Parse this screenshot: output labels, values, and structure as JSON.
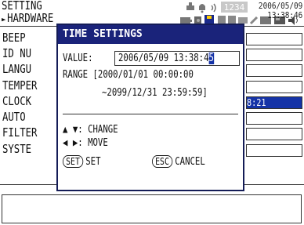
{
  "header": {
    "title": "SETTING",
    "subtitle": "HARDWARE",
    "date": "2006/05/09",
    "time": "13:38:46",
    "status_counter": "1234"
  },
  "menu": {
    "items": [
      "BEEP",
      "ID NU",
      "LANGU",
      "TEMPER",
      "CLOCK",
      "AUTO ",
      "FILTER",
      "SYSTE"
    ],
    "clock_value": "8:21"
  },
  "dialog": {
    "title": "TIME SETTINGS",
    "value_label": "VALUE:",
    "value_text": "2006/05/09 13:38:4",
    "value_cursor_char": "5",
    "range_line1": "RANGE [2000/01/01 00:00:00",
    "range_line2": "~2099/12/31 23:59:59]",
    "change_hint": "▲ ▼: CHANGE",
    "move_hint": "◀ ▶: MOVE",
    "set_key": "SET",
    "set_label": "SET",
    "esc_key": "ESC",
    "esc_label": "CANCEL"
  },
  "icons": [
    "usb-icon",
    "bell-icon",
    "sound-icon",
    "counter-icon",
    "battery-icon",
    "network-icon",
    "disk-icon",
    "document-icon",
    "plug-icon",
    "card-icon"
  ],
  "colors": {
    "highlight": "#1533a7",
    "dialog_title_bg": "#1a237a"
  }
}
